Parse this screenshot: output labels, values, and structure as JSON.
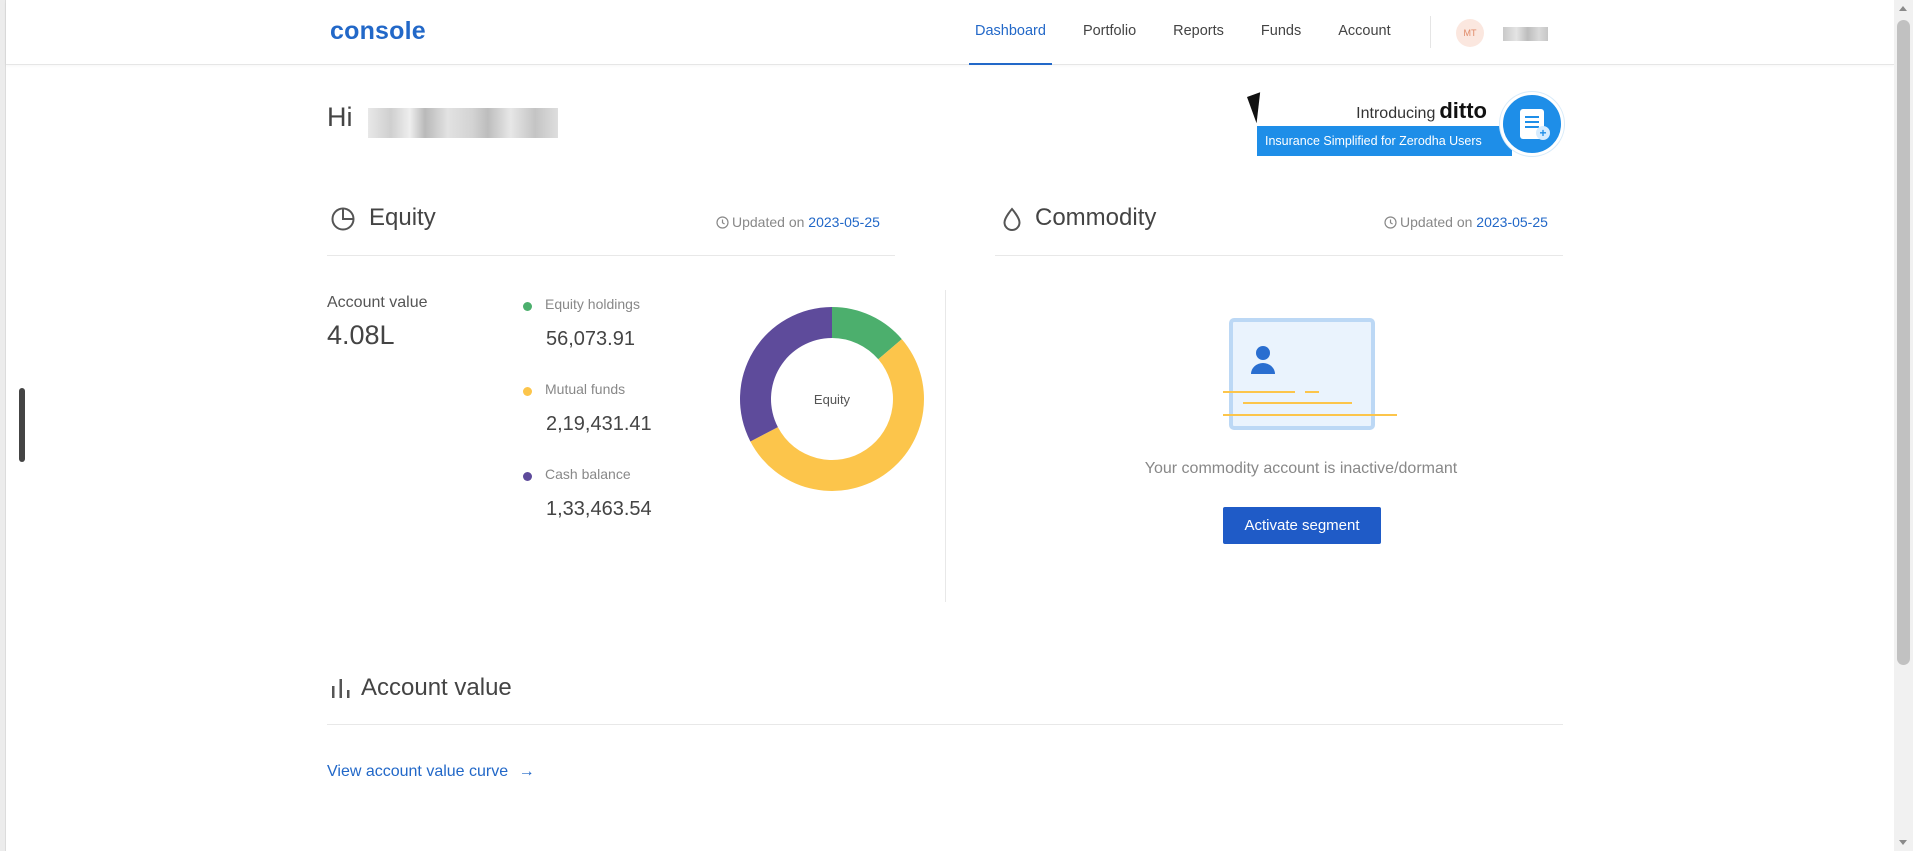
{
  "header": {
    "logo": "console",
    "nav": [
      {
        "label": "Dashboard",
        "active": true
      },
      {
        "label": "Portfolio",
        "active": false
      },
      {
        "label": "Reports",
        "active": false
      },
      {
        "label": "Funds",
        "active": false
      },
      {
        "label": "Account",
        "active": false
      }
    ],
    "avatar_initials": "MT"
  },
  "greeting": {
    "prefix": "Hi"
  },
  "ditto_banner": {
    "intro": "Introducing",
    "brand": "ditto",
    "tagline": "Insurance Simplified for Zerodha Users"
  },
  "equity": {
    "title": "Equity",
    "updated_prefix": "Updated on",
    "updated_date": "2023-05-25",
    "account_value_label": "Account value",
    "account_value": "4.08L",
    "donut_center_label": "Equity",
    "breakdown": [
      {
        "label": "Equity holdings",
        "value": "56,073.91",
        "color": "#4caf6d"
      },
      {
        "label": "Mutual funds",
        "value": "2,19,431.41",
        "color": "#fcc54b"
      },
      {
        "label": "Cash balance",
        "value": "1,33,463.54",
        "color": "#5e4b9b"
      }
    ]
  },
  "commodity": {
    "title": "Commodity",
    "updated_prefix": "Updated on",
    "updated_date": "2023-05-25",
    "status_text": "Your commodity account is inactive/dormant",
    "activate_label": "Activate segment"
  },
  "account_value_section": {
    "title": "Account value",
    "link_text": "View account value curve"
  },
  "colors": {
    "accent": "#2268c8",
    "button": "#1f5bc7",
    "ditto_blue": "#1e8ee8"
  }
}
